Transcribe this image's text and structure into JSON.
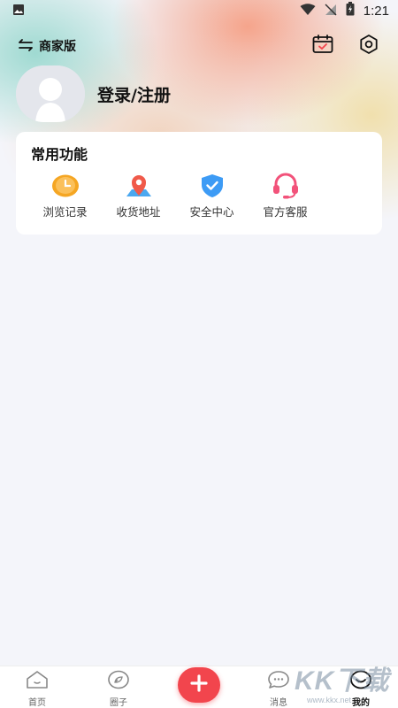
{
  "status_bar": {
    "time": "1:21"
  },
  "header": {
    "switch_label": "商家版"
  },
  "profile": {
    "login_text": "登录/注册"
  },
  "functions_card": {
    "title": "常用功能",
    "items": [
      {
        "label": "浏览记录",
        "icon": "clock-icon",
        "color": "#f5a623"
      },
      {
        "label": "收货地址",
        "icon": "location-pin-icon",
        "color": "#f05a4a"
      },
      {
        "label": "安全中心",
        "icon": "shield-check-icon",
        "color": "#3d9bf5"
      },
      {
        "label": "官方客服",
        "icon": "headset-icon",
        "color": "#f2527a"
      }
    ]
  },
  "tab_bar": {
    "tabs": [
      {
        "label": "首页",
        "icon": "home-icon"
      },
      {
        "label": "圈子",
        "icon": "circle-leaf-icon"
      },
      {
        "label": "消息",
        "icon": "chat-icon"
      },
      {
        "label": "我的",
        "icon": "face-icon",
        "active": true
      }
    ],
    "accent": "#f2454d"
  },
  "watermark": {
    "big": "KK下载",
    "small": "www.kkx.net"
  }
}
